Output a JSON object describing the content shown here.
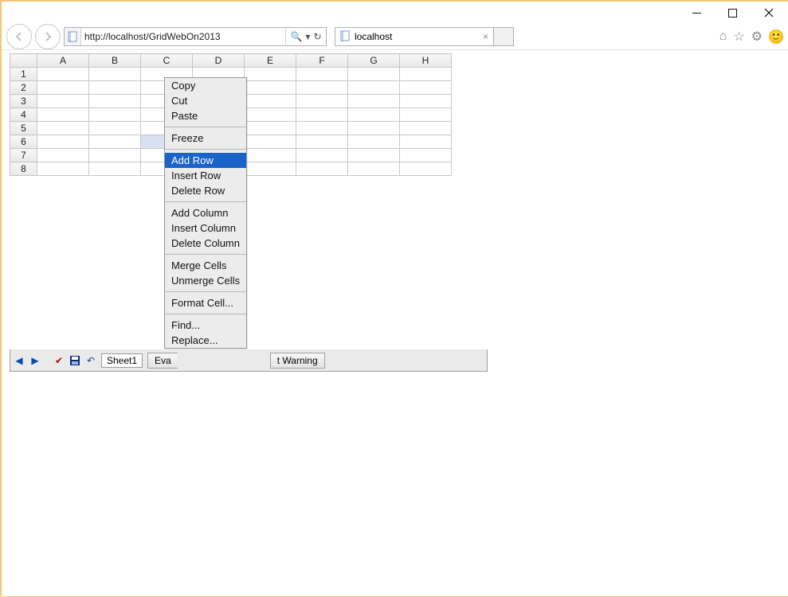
{
  "window": {
    "title": "localhost"
  },
  "nav": {
    "url": "http://localhost/GridWebOn2013"
  },
  "tab": {
    "title": "localhost"
  },
  "grid": {
    "columns": [
      "A",
      "B",
      "C",
      "D",
      "E",
      "F",
      "G",
      "H"
    ],
    "rows": [
      "1",
      "2",
      "3",
      "4",
      "5",
      "6",
      "7",
      "8"
    ],
    "selectedCell": "C6"
  },
  "toolbar": {
    "sheet": "Sheet1",
    "warn_btn": "t Warning",
    "eval_btn_fragment": "Eva"
  },
  "context_menu": {
    "items": [
      {
        "label": "Copy"
      },
      {
        "label": "Cut"
      },
      {
        "label": "Paste"
      },
      {
        "sep": true
      },
      {
        "label": "Freeze"
      },
      {
        "sep": true
      },
      {
        "label": "Add Row",
        "highlight": true
      },
      {
        "label": "Insert Row"
      },
      {
        "label": "Delete Row"
      },
      {
        "sep": true
      },
      {
        "label": "Add Column"
      },
      {
        "label": "Insert Column"
      },
      {
        "label": "Delete Column"
      },
      {
        "sep": true
      },
      {
        "label": "Merge Cells"
      },
      {
        "label": "Unmerge Cells"
      },
      {
        "sep": true
      },
      {
        "label": "Format Cell..."
      },
      {
        "sep": true
      },
      {
        "label": "Find..."
      },
      {
        "label": "Replace..."
      }
    ]
  }
}
